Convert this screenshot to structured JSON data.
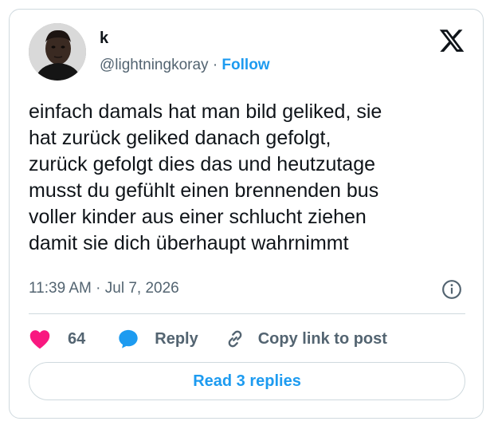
{
  "tweet": {
    "author_name": "k",
    "handle": "@lightningkoray",
    "separator": "·",
    "follow_label": "Follow",
    "text": "einfach damals hat man bild geliked, sie\nhat zurück geliked danach gefolgt,\nzurück gefolgt dies das und heutzutage\nmusst du gefühlt einen brennenden bus\nvoller kinder aus einer schlucht ziehen\ndamit sie dich überhaupt wahrnimmt",
    "timestamp": "11:39 AM · Jul 7, 2026"
  },
  "actions": {
    "like_count": "64",
    "reply_label": "Reply",
    "copy_label": "Copy link to post"
  },
  "read_replies_label": "Read 3 replies",
  "icons": {
    "logo": "x-logo-icon",
    "info": "info-icon",
    "like": "heart-icon",
    "reply": "speech-bubble-icon",
    "copy": "link-icon"
  },
  "colors": {
    "accent": "#1d9bf0",
    "like": "#f91880",
    "text": "#0f1419",
    "muted": "#536471",
    "border": "#cfd9de"
  }
}
